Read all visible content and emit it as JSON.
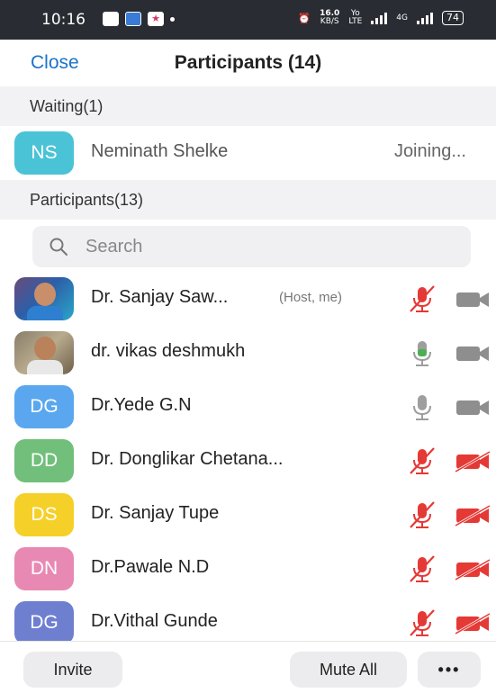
{
  "status_bar": {
    "time": "10:16",
    "speed_value": "16.0",
    "speed_unit": "KB/S",
    "volte_top": "Yo",
    "volte_bottom": "LTE",
    "network": "4G",
    "battery": "74"
  },
  "header": {
    "close_label": "Close",
    "title": "Participants (14)"
  },
  "waiting": {
    "header": "Waiting(1)",
    "items": [
      {
        "initials": "NS",
        "name": "Neminath Shelke",
        "status": "Joining...",
        "avatar_color": "#4bc3d6"
      }
    ]
  },
  "participants_section": {
    "header": "Participants(13)"
  },
  "search": {
    "placeholder": "Search"
  },
  "participants": [
    {
      "initials": "",
      "name": "Dr. Sanjay Saw...",
      "tag": "(Host, me)",
      "avatar": "photo",
      "mic": "muted",
      "video": "on"
    },
    {
      "initials": "",
      "name": "dr. vikas deshmukh",
      "tag": "",
      "avatar": "photo",
      "mic": "speaking",
      "video": "on"
    },
    {
      "initials": "DG",
      "name": "Dr.Yede G.N",
      "tag": "",
      "avatar_color": "#5aa7f0",
      "mic": "unmuted",
      "video": "on"
    },
    {
      "initials": "DD",
      "name": "Dr. Donglikar Chetana...",
      "tag": "",
      "avatar_color": "#71bf7a",
      "mic": "muted",
      "video": "off"
    },
    {
      "initials": "DS",
      "name": "Dr. Sanjay Tupe",
      "tag": "",
      "avatar_color": "#f5d028",
      "mic": "muted",
      "video": "off"
    },
    {
      "initials": "DN",
      "name": "Dr.Pawale N.D",
      "tag": "",
      "avatar_color": "#e889b4",
      "mic": "muted",
      "video": "off"
    },
    {
      "initials": "DG",
      "name": "Dr.Vithal Gunde",
      "tag": "",
      "avatar_color": "#6f7fd0",
      "mic": "muted",
      "video": "off"
    }
  ],
  "footer": {
    "invite_label": "Invite",
    "mute_all_label": "Mute All",
    "more_label": "•••"
  },
  "colors": {
    "accent": "#1a73c8",
    "muted_red": "#e53935",
    "speaking_green": "#4caf50",
    "icon_gray": "#9e9e9e"
  }
}
